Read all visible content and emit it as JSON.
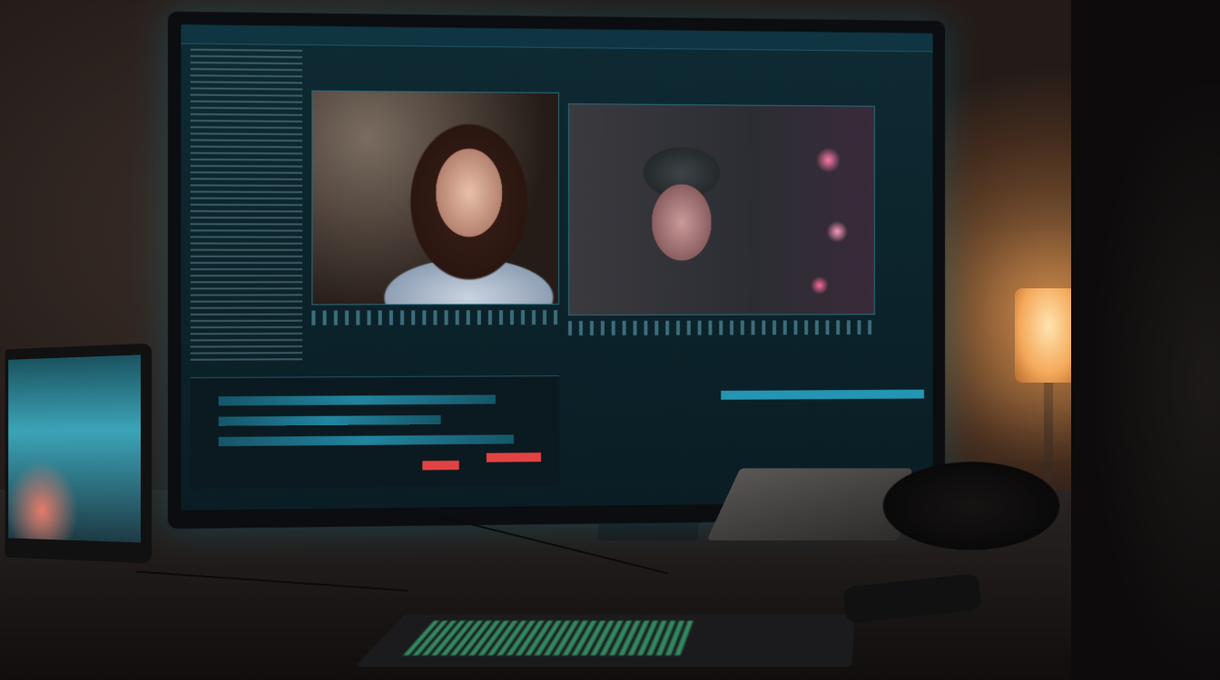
{
  "scene": {
    "description_tags": [
      "video-editor-monitor-icon",
      "laptop-icon",
      "keyboard-icon",
      "lamp-icon",
      "person-silhouette-icon"
    ],
    "colors": {
      "screen_accent": "#2ab3d6",
      "warm_light": "#f4a95a",
      "keyboard_glow": "#46e696",
      "timeline_marker": "#e34242"
    }
  }
}
